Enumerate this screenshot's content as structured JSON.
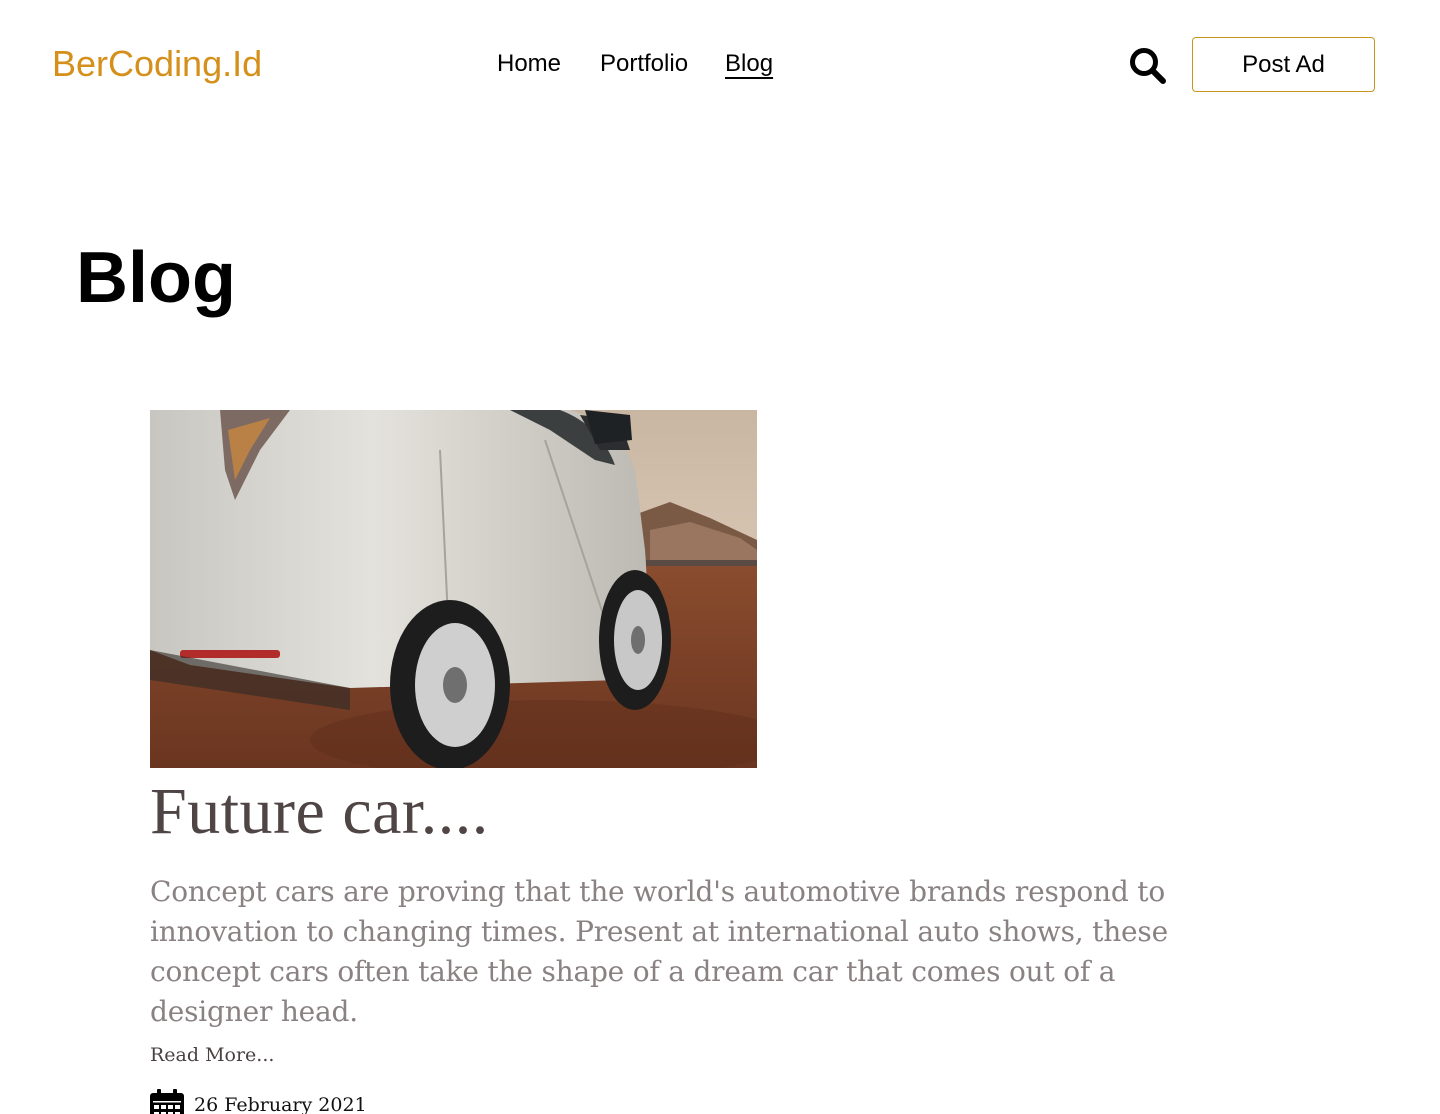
{
  "header": {
    "logo": "BerCoding.Id",
    "nav": [
      {
        "label": "Home"
      },
      {
        "label": "Portfolio"
      },
      {
        "label": "Blog",
        "active": true
      }
    ],
    "search_icon": "search-icon",
    "post_ad_label": "Post Ad"
  },
  "colors": {
    "brand": "#D4901A",
    "title": "#4f4545",
    "excerpt": "#8a8282"
  },
  "main": {
    "title": "Blog",
    "article": {
      "image": "white minivan on desert road",
      "title": "Future car....",
      "excerpt": "Concept cars are proving that the world's automotive brands respond to innovation to changing times. Present at international auto shows, these concept cars often take the shape of a dream car that comes out of a designer head.",
      "read_more": "Read More...",
      "date_icon": "calendar-icon",
      "date": "26 February 2021"
    }
  }
}
